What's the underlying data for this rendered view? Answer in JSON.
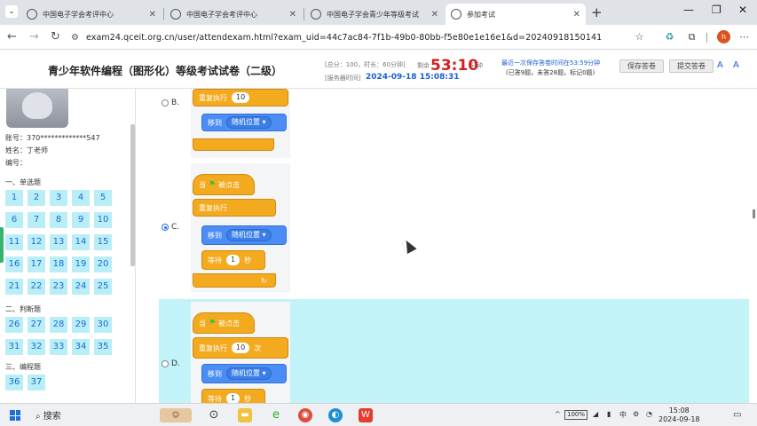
{
  "browser": {
    "tabs": [
      {
        "title": "中国电子学会考评中心",
        "active": false
      },
      {
        "title": "中国电子学会考评中心",
        "active": false
      },
      {
        "title": "中国电子学会青少年等级考试",
        "active": false
      },
      {
        "title": "参加考试",
        "active": true
      }
    ],
    "url": "exam24.qceit.org.cn/user/attendexam.html?exam_uid=44c7ac84-7f1b-49b0-80bb-f5e80e1e16e1&d=20240918150141",
    "profile_initial": "h"
  },
  "header": {
    "title": "青少年软件编程（图形化）等级考试试卷（二级）",
    "meta_score": "[总分：100，时长：60分钟]",
    "meta_start_label": "[服务器时间]",
    "remaining_label": "剩余",
    "countdown": "53:10",
    "countdown_unit": "分钟",
    "start_time": "2024-09-18 15:08:31",
    "save_note": "最近一次保存答卷时间在53:59分钟",
    "save_stats": "(已答9题，未答28题，标记0题)",
    "save_button": "保存答卷",
    "submit_button": "提交答卷"
  },
  "sidebar": {
    "account_label": "账号：",
    "account": "370*************547",
    "name_label": "姓名：",
    "name": "丁老师",
    "id_label": "编号：",
    "id_value": "",
    "sections": [
      {
        "title": "一、单选题",
        "questions": [
          "1",
          "2",
          "3",
          "4",
          "5",
          "6",
          "7",
          "8",
          "9",
          "10",
          "11",
          "12",
          "13",
          "14",
          "15",
          "16",
          "17",
          "18",
          "19",
          "20",
          "21",
          "22",
          "23",
          "24",
          "25"
        ]
      },
      {
        "title": "二、判断题",
        "questions": [
          "26",
          "27",
          "28",
          "29",
          "30",
          "31",
          "32",
          "33",
          "34",
          "35"
        ]
      },
      {
        "title": "三、编程题",
        "questions": [
          "36",
          "37"
        ]
      }
    ]
  },
  "options": {
    "b_label": "B.",
    "c_label": "C.",
    "d_label": "D.",
    "selected": "C"
  },
  "blocks": {
    "when_flag": "当",
    "when_clicked": "被点击",
    "repeat": "重复执行",
    "repeat_times_suffix": "次",
    "repeat_count": "10",
    "move_to": "移到",
    "random_position": "随机位置 ▾",
    "wait": "等待",
    "wait_value": "1",
    "wait_suffix": "秒"
  },
  "taskbar": {
    "search": "搜索",
    "battery": "100%",
    "ime": "中",
    "time": "15:08",
    "date": "2024-09-18"
  }
}
